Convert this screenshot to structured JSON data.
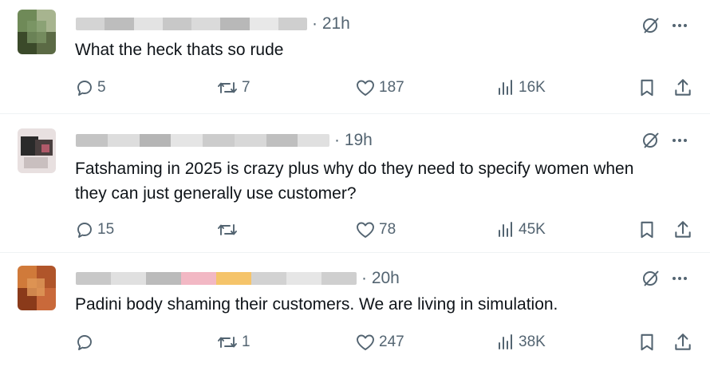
{
  "posts": [
    {
      "time": "· 21h",
      "text": "What the heck thats so rude",
      "replies": "5",
      "reposts": "7",
      "likes": "187",
      "views": "16K",
      "avatar_colors": [
        "#5b6a45",
        "#7f9a6a",
        "#3b4a2a",
        "#a7b48f",
        "#2e3a22",
        "#6f8a58"
      ],
      "name_blur_colors": [
        "#d4d4d4",
        "#bdbdbd",
        "#e3e3e3",
        "#c8c8c8",
        "#dadada",
        "#b8b8b8",
        "#e8e8e8",
        "#cfcfcf"
      ]
    },
    {
      "time": "· 19h",
      "text": "Fatshaming in 2025 is crazy plus why do they need to specify women when\nthey can just generally use customer?",
      "replies": "15",
      "reposts": "",
      "likes": "78",
      "views": "45K",
      "avatar_colors": [
        "#2a2a2a",
        "#8a7a7a",
        "#c9bfbf",
        "#4a3f3f",
        "#b05a6a",
        "#e8e0e0"
      ],
      "name_blur_colors": [
        "#c4c4c4",
        "#dddddd",
        "#b5b5b5",
        "#e5e5e5",
        "#cccccc",
        "#d8d8d8",
        "#bfbfbf",
        "#e0e0e0"
      ]
    },
    {
      "time": "· 20h",
      "text": "Padini body shaming their customers. We are living in simulation.",
      "replies": "",
      "reposts": "1",
      "likes": "247",
      "views": "38K",
      "avatar_colors": [
        "#b0552a",
        "#d07a3a",
        "#8a3a1a",
        "#c9693a",
        "#e09a5a",
        "#7a2f15"
      ],
      "name_blur_colors": [
        "#c8c8c8",
        "#e0e0e0",
        "#bbbbbb",
        "#f2b8c4",
        "#f5c46a",
        "#d2d2d2",
        "#e6e6e6",
        "#cfcfcf"
      ]
    }
  ],
  "icons": {
    "reply": "reply-icon",
    "repost": "repost-icon",
    "like": "like-icon",
    "views": "views-icon",
    "bookmark": "bookmark-icon",
    "share": "share-icon",
    "grok": "grok-icon",
    "more": "more-icon"
  },
  "colors": {
    "text_primary": "#0f1419",
    "text_secondary": "#536471",
    "divider": "#eff3f4"
  }
}
